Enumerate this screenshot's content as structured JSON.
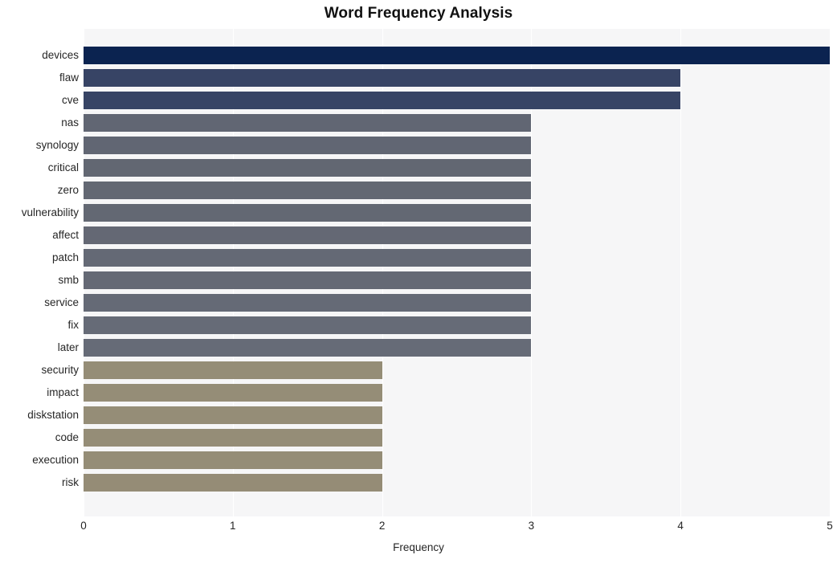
{
  "chart_data": {
    "type": "bar",
    "orientation": "horizontal",
    "title": "Word Frequency Analysis",
    "xlabel": "Frequency",
    "ylabel": "",
    "xlim": [
      0,
      5
    ],
    "ylim": null,
    "grid": true,
    "legend": null,
    "xticks": [
      "0",
      "1",
      "2",
      "3",
      "4",
      "5"
    ],
    "xtick_values": [
      0,
      1,
      2,
      3,
      4,
      5
    ],
    "categories": [
      "devices",
      "flaw",
      "cve",
      "nas",
      "synology",
      "critical",
      "zero",
      "vulnerability",
      "affect",
      "patch",
      "smb",
      "service",
      "fix",
      "later",
      "security",
      "impact",
      "diskstation",
      "code",
      "execution",
      "risk"
    ],
    "values": [
      5,
      4,
      4,
      3,
      3,
      3,
      3,
      3,
      3,
      3,
      3,
      3,
      3,
      3,
      2,
      2,
      2,
      2,
      2,
      2
    ],
    "bar_colors": [
      "#0b2350",
      "#374465",
      "#374465",
      "#616673",
      "#616673",
      "#626772",
      "#636873",
      "#636873",
      "#646874",
      "#646975",
      "#656975",
      "#656a76",
      "#666b77",
      "#666b77",
      "#958d77",
      "#958d77",
      "#958d77",
      "#958d77",
      "#958d77",
      "#958c76"
    ]
  },
  "style": {
    "plot_background": "#f6f6f7",
    "figure_background": "#ffffff",
    "gridline_color": "#ffffff",
    "text_color": "#262626",
    "title_color": "#111111"
  }
}
